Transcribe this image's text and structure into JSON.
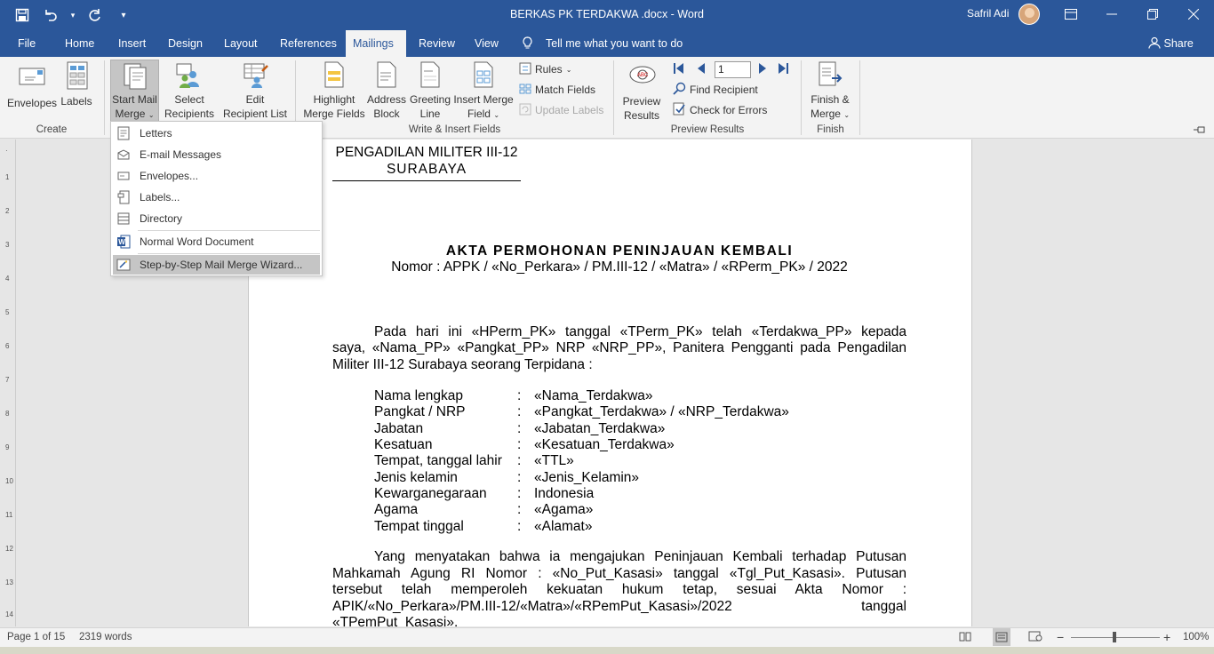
{
  "title_bar": {
    "document_title": "BERKAS PK TERDAKWA .docx  -  Word",
    "user_name": "Safril Adi",
    "qat_icons": [
      "save-icon",
      "undo-icon",
      "redo-icon",
      "customize-icon"
    ],
    "window_controls": [
      "ribbon-display-icon",
      "minimize-icon",
      "restore-icon",
      "close-icon"
    ]
  },
  "tabs": [
    "File",
    "Home",
    "Insert",
    "Design",
    "Layout",
    "References",
    "Mailings",
    "Review",
    "View"
  ],
  "active_tab": "Mailings",
  "tell_me": "Tell me what you want to do",
  "share": "Share",
  "ribbon": {
    "create": {
      "label": "Create",
      "envelopes": "Envelopes",
      "labels": "Labels"
    },
    "start": {
      "start_mail_merge": "Start Mail",
      "start_mail_merge_2": "Merge",
      "select_recipients": "Select",
      "select_recipients_2": "Recipients",
      "edit_list": "Edit",
      "edit_list_2": "Recipient List"
    },
    "write": {
      "label": "Write & Insert Fields",
      "highlight": "Highlight",
      "highlight_2": "Merge Fields",
      "address": "Address",
      "address_2": "Block",
      "greeting": "Greeting",
      "greeting_2": "Line",
      "insert_field": "Insert Merge",
      "insert_field_2": "Field",
      "rules": "Rules",
      "match_fields": "Match Fields",
      "update_labels": "Update Labels"
    },
    "preview": {
      "label": "Preview Results",
      "preview_results": "Preview",
      "preview_results_2": "Results",
      "record_number": "1",
      "find_recipient": "Find Recipient",
      "check_errors": "Check for Errors"
    },
    "finish": {
      "label": "Finish",
      "finish_merge": "Finish &",
      "finish_merge_2": "Merge"
    }
  },
  "dropdown": {
    "items": [
      {
        "label": "Letters",
        "icon": "letter-icon"
      },
      {
        "label": "E-mail Messages",
        "icon": "email-icon"
      },
      {
        "label": "Envelopes...",
        "icon": "envelope-icon"
      },
      {
        "label": "Labels...",
        "icon": "labels-icon"
      },
      {
        "label": "Directory",
        "icon": "directory-icon"
      },
      {
        "label": "Normal Word Document",
        "icon": "word-icon"
      },
      {
        "label": "Step-by-Step Mail Merge Wizard...",
        "icon": "wizard-icon"
      }
    ]
  },
  "document": {
    "header_line1": "PENGADILAN MILITER III-12",
    "header_line2": "SURABAYA",
    "title": "AKTA PERMOHONAN PENINJAUAN KEMBALI",
    "nomor": "Nomor  :  APPK / «No_Perkara» / PM.III-12 / «Matra» / «RPerm_PK» / 2022",
    "para1_line1": "Pada hari ini «HPerm_PK» tanggal «TPerm_PK» telah «Terdakwa_PP» kepada",
    "para1_line2": "saya, «Nama_PP» «Pangkat_PP» NRP «NRP_PP», Panitera Pengganti pada Pengadilan",
    "para1_line3": "Militer III-12 Surabaya seorang Terpidana :",
    "fields": [
      {
        "label": "Nama lengkap",
        "value": "«Nama_Terdakwa»"
      },
      {
        "label": "Pangkat / NRP",
        "value": "«Pangkat_Terdakwa» / «NRP_Terdakwa»"
      },
      {
        "label": "Jabatan",
        "value": "«Jabatan_Terdakwa»"
      },
      {
        "label": "Kesatuan",
        "value": "«Kesatuan_Terdakwa»"
      },
      {
        "label": "Tempat, tanggal  lahir",
        "value": "«TTL»"
      },
      {
        "label": "Jenis kelamin",
        "value": "«Jenis_Kelamin»"
      },
      {
        "label": "Kewarganegaraan",
        "value": "Indonesia"
      },
      {
        "label": "Agama",
        "value": "«Agama»"
      },
      {
        "label": "Tempat tinggal",
        "value": "«Alamat»"
      }
    ],
    "colon": ":",
    "para2_line1": "Yang menyatakan bahwa ia mengajukan Peninjauan Kembali terhadap Putusan",
    "para2_line2": "Mahkamah Agung RI Nomor : «No_Put_Kasasi» tanggal «Tgl_Put_Kasasi». Putusan",
    "para2_line3": "tersebut telah memperoleh kekuatan hukum tetap, sesuai Akta Nomor :",
    "para2_line4": "APIK/«No_Perkara»/PM.III-12/«Matra»/«RPemPut_Kasasi»/2022 tanggal",
    "para2_line5": "«TPemPut_Kasasi»."
  },
  "status": {
    "page": "Page 1 of 15",
    "words": "2319 words",
    "zoom": "100%"
  }
}
